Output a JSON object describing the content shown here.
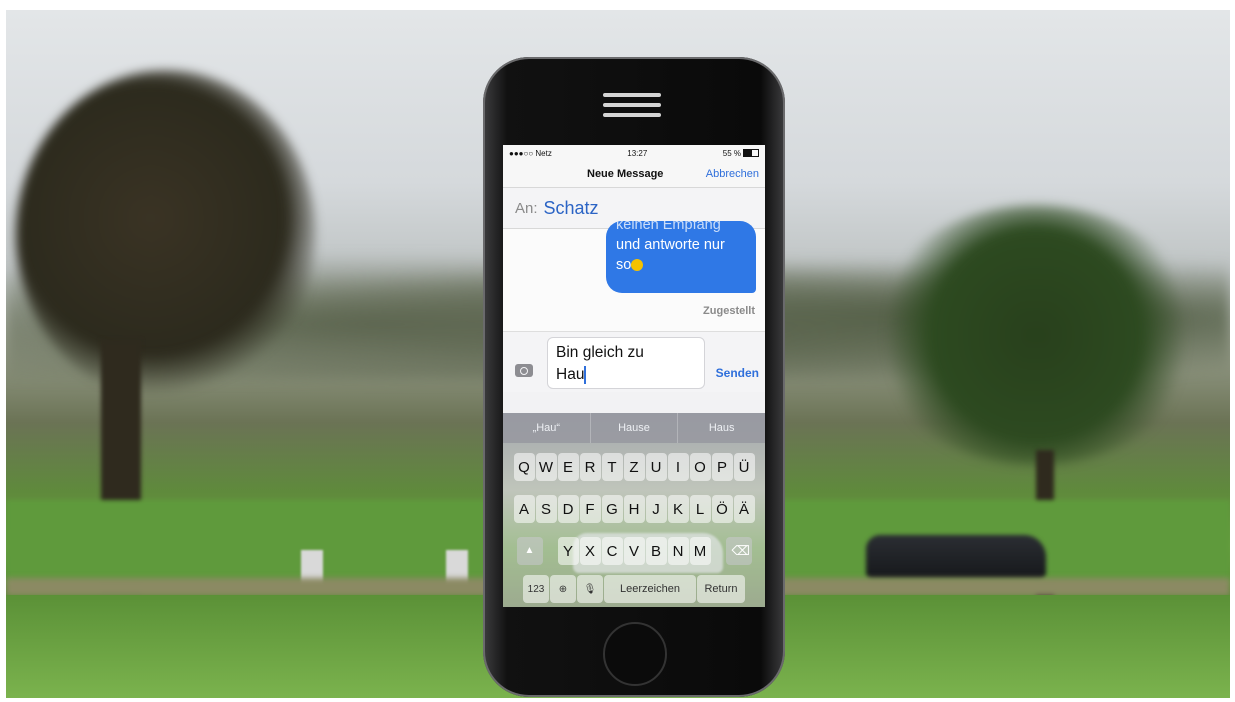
{
  "status": {
    "carrier": "●●●○○ Netz",
    "time": "13:27",
    "battery": "55 %"
  },
  "nav": {
    "title": "Neue Message",
    "cancel": "Abbrechen"
  },
  "recipient": {
    "label": "An:",
    "name": "Schatz"
  },
  "message": {
    "line1": "keinen Empfang",
    "line2": "und antworte nur",
    "line3": "so",
    "status": "Zugestellt"
  },
  "compose": {
    "line1": "Bin gleich zu",
    "line2": "Hau",
    "send": "Senden"
  },
  "suggestions": [
    "„Hau“",
    "Hause",
    "Haus"
  ],
  "keyboard": {
    "row1": [
      "Q",
      "W",
      "E",
      "R",
      "T",
      "Z",
      "U",
      "I",
      "O",
      "P",
      "Ü"
    ],
    "row2": [
      "A",
      "S",
      "D",
      "F",
      "G",
      "H",
      "J",
      "K",
      "L",
      "Ö",
      "Ä"
    ],
    "row3": [
      "Y",
      "X",
      "C",
      "V",
      "B",
      "N",
      "M"
    ],
    "numbers": "123",
    "space": "Leerzeichen",
    "return": "Return"
  },
  "icons": [
    "signal-icon",
    "battery-icon",
    "camera-icon",
    "globe-icon",
    "microphone-icon",
    "shift-icon",
    "backspace-icon",
    "emoji-icon"
  ]
}
